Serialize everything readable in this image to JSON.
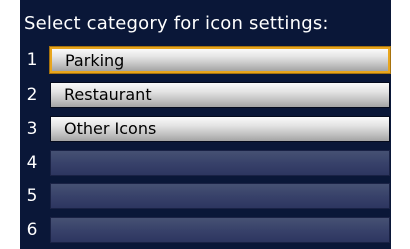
{
  "title": "Select category for icon settings:",
  "rows": [
    {
      "number": "1",
      "label": "Parking",
      "selected": true
    },
    {
      "number": "2",
      "label": "Restaurant",
      "selected": false
    },
    {
      "number": "3",
      "label": "Other Icons",
      "selected": false
    },
    {
      "number": "4",
      "label": "",
      "selected": false
    },
    {
      "number": "5",
      "label": "",
      "selected": false
    },
    {
      "number": "6",
      "label": "",
      "selected": false
    }
  ]
}
